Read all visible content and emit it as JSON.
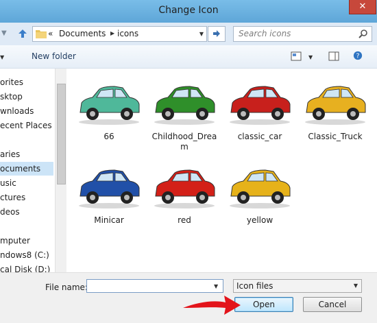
{
  "window": {
    "title": "Change Icon",
    "close_label": "✕"
  },
  "address": {
    "overflow": "«",
    "crumbs": [
      "Documents",
      "icons"
    ]
  },
  "search": {
    "placeholder": "Search icons"
  },
  "toolbar": {
    "new_folder_label": "New folder"
  },
  "nav": {
    "items": [
      {
        "label": "orites",
        "selected": false
      },
      {
        "label": "sktop",
        "selected": false
      },
      {
        "label": "wnloads",
        "selected": false
      },
      {
        "label": "ecent Places",
        "selected": false
      },
      {
        "label": "",
        "selected": false
      },
      {
        "label": "aries",
        "selected": false
      },
      {
        "label": "ocuments",
        "selected": true
      },
      {
        "label": "usic",
        "selected": false
      },
      {
        "label": "ctures",
        "selected": false
      },
      {
        "label": "deos",
        "selected": false
      },
      {
        "label": "",
        "selected": false
      },
      {
        "label": "mputer",
        "selected": false
      },
      {
        "label": "ndows8 (C:)",
        "selected": false
      },
      {
        "label": "cal Disk (D:)",
        "selected": false
      }
    ]
  },
  "files": [
    {
      "name": "66",
      "color": "#4fb89a"
    },
    {
      "name": "Childhood_Dream",
      "color": "#2f8f2a"
    },
    {
      "name": "classic_car",
      "color": "#c8201c"
    },
    {
      "name": "Classic_Truck",
      "color": "#e7b020"
    },
    {
      "name": "Minicar",
      "color": "#2150a8"
    },
    {
      "name": "red",
      "color": "#d32018"
    },
    {
      "name": "yellow",
      "color": "#e6b21a"
    }
  ],
  "footer": {
    "file_name_label": "File name:",
    "file_name_value": "",
    "file_type": "Icon files",
    "open_label": "Open",
    "cancel_label": "Cancel"
  },
  "colors": {
    "title_bar": "#6eb0dd",
    "close_button": "#c7483b",
    "selection": "#cce4f7",
    "annotation_arrow": "#e3141b"
  }
}
